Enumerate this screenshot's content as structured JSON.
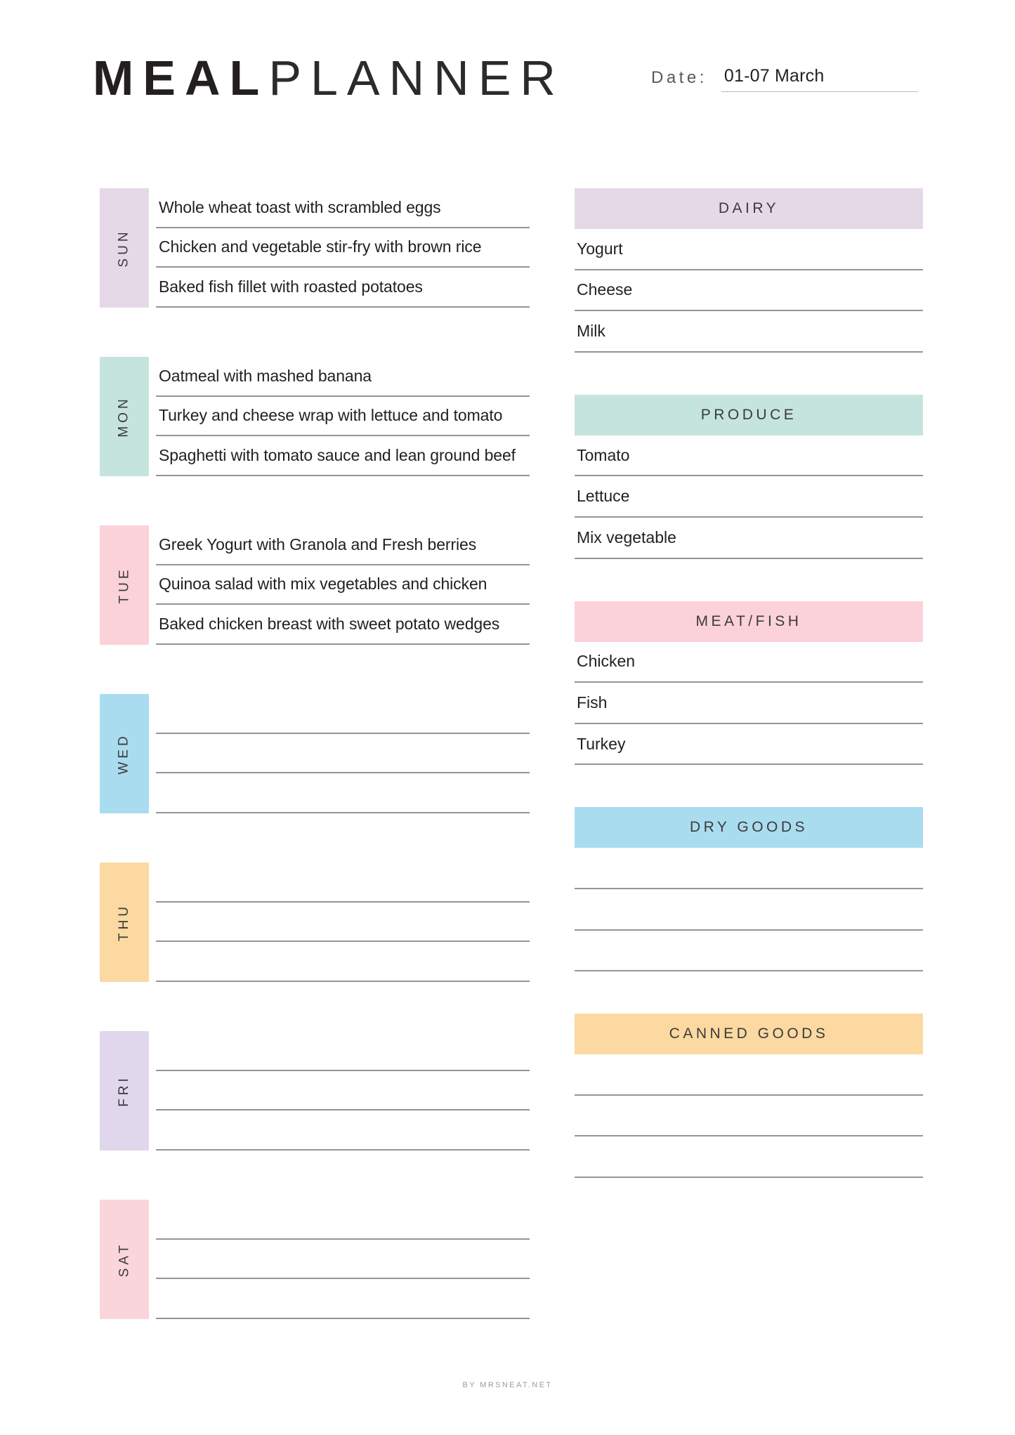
{
  "header": {
    "title_bold": "MEAL",
    "title_light": "PLANNER",
    "date_label": "Date:",
    "date_value": "01-07 March"
  },
  "days": [
    {
      "abbr": "SUN",
      "color": "#e5d9e8",
      "meals": [
        "Whole wheat toast with scrambled eggs",
        "Chicken and vegetable stir-fry with brown rice",
        "Baked fish fillet with roasted potatoes"
      ]
    },
    {
      "abbr": "MON",
      "color": "#c5e4dd",
      "meals": [
        "Oatmeal with mashed banana",
        "Turkey and cheese wrap with lettuce and tomato",
        "Spaghetti with tomato sauce and lean ground beef"
      ]
    },
    {
      "abbr": "TUE",
      "color": "#fbd2d9",
      "meals": [
        "Greek Yogurt with Granola and Fresh berries",
        "Quinoa salad with mix vegetables and chicken",
        "Baked chicken breast with sweet potato wedges"
      ]
    },
    {
      "abbr": "WED",
      "color": "#aadcf0",
      "meals": [
        "",
        "",
        ""
      ]
    },
    {
      "abbr": "THU",
      "color": "#fcd9a0",
      "meals": [
        "",
        "",
        ""
      ]
    },
    {
      "abbr": "FRI",
      "color": "#e0d7ec",
      "meals": [
        "",
        "",
        ""
      ]
    },
    {
      "abbr": "SAT",
      "color": "#fbd5dc",
      "meals": [
        "",
        "",
        ""
      ]
    }
  ],
  "categories": [
    {
      "name": "DAIRY",
      "color": "#e5d9e8",
      "items": [
        "Yogurt",
        "Cheese",
        "Milk"
      ]
    },
    {
      "name": "PRODUCE",
      "color": "#c5e4dd",
      "items": [
        "Tomato",
        "Lettuce",
        "Mix vegetable"
      ]
    },
    {
      "name": "MEAT/FISH",
      "color": "#fbd2d9",
      "items": [
        "Chicken",
        "Fish",
        "Turkey"
      ]
    },
    {
      "name": "DRY GOODS",
      "color": "#aadcf0",
      "items": [
        "",
        "",
        ""
      ]
    },
    {
      "name": "CANNED GOODS",
      "color": "#fcd9a0",
      "items": [
        "",
        "",
        ""
      ]
    }
  ],
  "footer": {
    "credit": "BY MRSNEAT.NET"
  }
}
